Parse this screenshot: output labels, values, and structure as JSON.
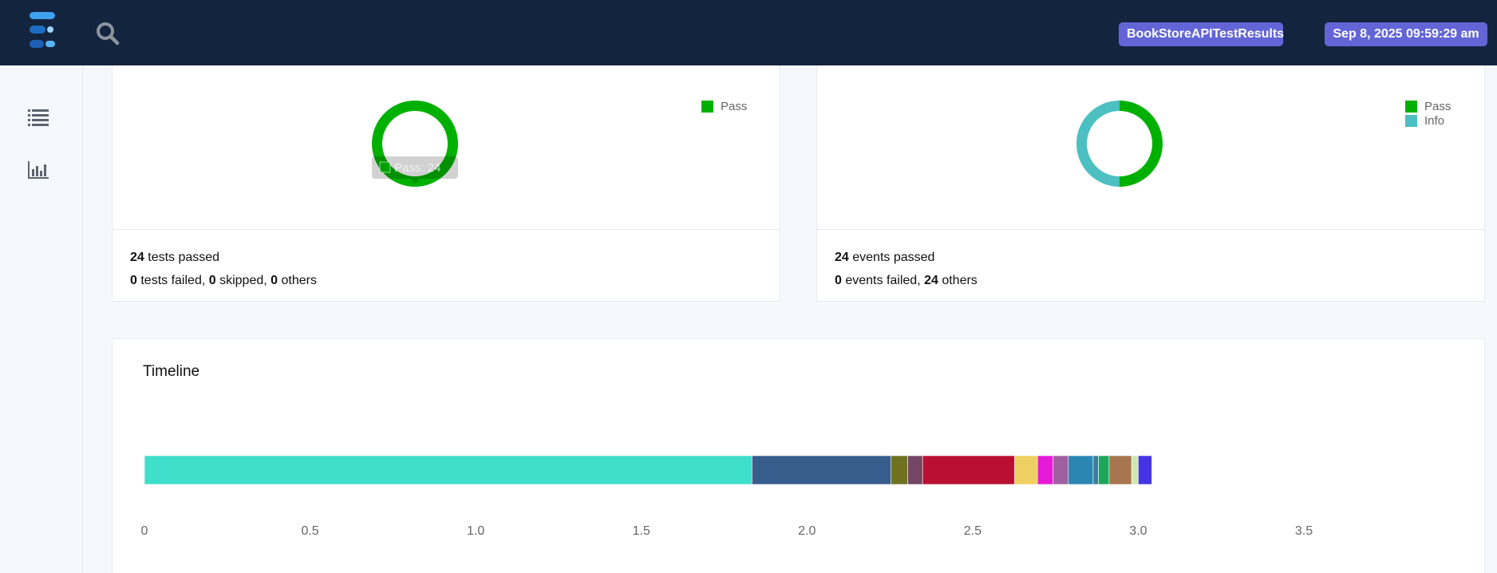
{
  "header": {
    "report_name": "BookStoreAPITestResults",
    "timestamp": "Sep 8, 2025 09:59:29 am",
    "logo_icon": "extent-logo-icon",
    "search_icon": "search-icon"
  },
  "sidebar": {
    "items": [
      {
        "icon": "list-icon"
      },
      {
        "icon": "bar-chart-icon"
      }
    ]
  },
  "tests_card": {
    "legend": [
      {
        "label": "Pass",
        "color": "#00b000"
      }
    ],
    "donut": [
      {
        "label": "Pass",
        "value": 24,
        "color": "#00b000"
      }
    ],
    "tooltip": "Pass: 24",
    "passed_count": "24",
    "passed_text": " tests passed",
    "failed_count": "0",
    "failed_text": " tests failed, ",
    "skipped_count": "0",
    "skipped_text": " skipped, ",
    "others_count": "0",
    "others_text": " others"
  },
  "events_card": {
    "legend": [
      {
        "label": "Pass",
        "color": "#00b000"
      },
      {
        "label": "Info",
        "color": "#4cbfc1"
      }
    ],
    "donut": [
      {
        "label": "Pass",
        "value": 24,
        "color": "#00b000"
      },
      {
        "label": "Info",
        "value": 24,
        "color": "#4cbfc1"
      }
    ],
    "passed_count": "24",
    "passed_text": " events passed",
    "failed_count": "0",
    "failed_text": " events failed, ",
    "others_count": "24",
    "others_text": " others"
  },
  "timeline": {
    "title": "Timeline"
  },
  "chart_data": {
    "type": "bar",
    "orientation": "horizontal-stacked",
    "x_ticks": [
      "0",
      "0.5",
      "1.0",
      "1.5",
      "2.0",
      "2.5",
      "3.0",
      "3.5"
    ],
    "xlim": [
      0,
      3.5
    ],
    "grid": false,
    "series": [
      {
        "start": 0.0,
        "end": 1.834,
        "color": "#40dfcc"
      },
      {
        "start": 1.834,
        "end": 2.253,
        "color": "#375d8c"
      },
      {
        "start": 2.253,
        "end": 2.304,
        "color": "#6e721f"
      },
      {
        "start": 2.304,
        "end": 2.349,
        "color": "#734663"
      },
      {
        "start": 2.349,
        "end": 2.627,
        "color": "#ba0f33"
      },
      {
        "start": 2.627,
        "end": 2.696,
        "color": "#eecf62"
      },
      {
        "start": 2.696,
        "end": 2.743,
        "color": "#e51ad7"
      },
      {
        "start": 2.743,
        "end": 2.789,
        "color": "#a0609f"
      },
      {
        "start": 2.789,
        "end": 2.864,
        "color": "#2b86b4"
      },
      {
        "start": 2.864,
        "end": 2.88,
        "color": "#3b7c97"
      },
      {
        "start": 2.88,
        "end": 2.912,
        "color": "#1ba75a"
      },
      {
        "start": 2.912,
        "end": 2.98,
        "color": "#a6774e"
      },
      {
        "start": 2.98,
        "end": 3.0,
        "color": "#cde8b2"
      },
      {
        "start": 3.0,
        "end": 3.041,
        "color": "#4534e4"
      }
    ]
  }
}
